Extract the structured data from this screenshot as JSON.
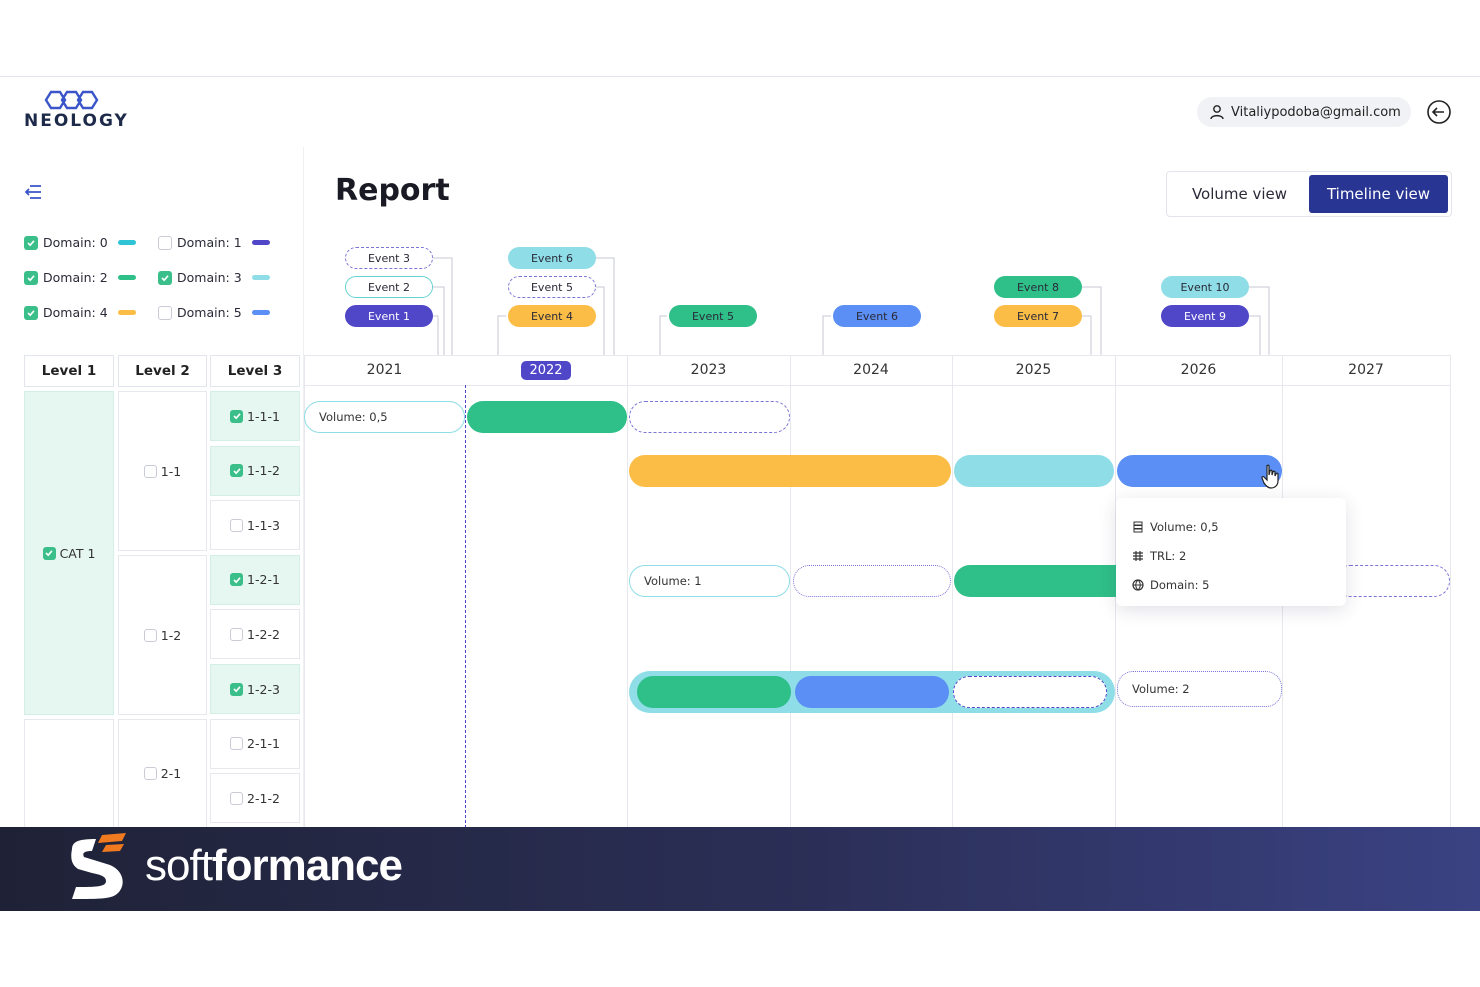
{
  "app": {
    "logo_text": "NEOLOGY",
    "user_email": "Vitaliypodoba@gmail.com"
  },
  "page": {
    "title": "Report",
    "views": [
      "Volume view",
      "Timeline view"
    ],
    "active_view": "Timeline view"
  },
  "legend": [
    {
      "label": "Domain: 0",
      "checked": true,
      "color": "#2ec4d6"
    },
    {
      "label": "Domain: 1",
      "checked": false,
      "color": "#5046c8"
    },
    {
      "label": "Domain: 2",
      "checked": true,
      "color": "#2fbf88"
    },
    {
      "label": "Domain: 3",
      "checked": true,
      "color": "#8fdde6"
    },
    {
      "label": "Domain: 4",
      "checked": true,
      "color": "#fbbd45"
    },
    {
      "label": "Domain: 5",
      "checked": false,
      "color": "#5b8ff5"
    }
  ],
  "tree": {
    "headers": [
      "Level 1",
      "Level 2",
      "Level 3"
    ],
    "level1": [
      {
        "label": "CAT 1",
        "checked": true
      }
    ],
    "level2": [
      {
        "label": "1-1",
        "checked": false
      },
      {
        "label": "1-2",
        "checked": false
      },
      {
        "label": "2-1",
        "checked": false
      }
    ],
    "level3": [
      {
        "label": "1-1-1",
        "checked": true
      },
      {
        "label": "1-1-2",
        "checked": true
      },
      {
        "label": "1-1-3",
        "checked": false
      },
      {
        "label": "1-2-1",
        "checked": true
      },
      {
        "label": "1-2-2",
        "checked": false
      },
      {
        "label": "1-2-3",
        "checked": true
      },
      {
        "label": "2-1-1",
        "checked": false
      },
      {
        "label": "2-1-2",
        "checked": false
      }
    ]
  },
  "timeline": {
    "years": [
      "2021",
      "2022",
      "2023",
      "2024",
      "2025",
      "2026",
      "2027"
    ],
    "current_year": "2022",
    "events": [
      {
        "label": "Event 3"
      },
      {
        "label": "Event 2"
      },
      {
        "label": "Event 1"
      },
      {
        "label": "Event 6"
      },
      {
        "label": "Event 5"
      },
      {
        "label": "Event 4"
      },
      {
        "label": "Event 5"
      },
      {
        "label": "Event 6"
      },
      {
        "label": "Event 8"
      },
      {
        "label": "Event 7"
      },
      {
        "label": "Event 10"
      },
      {
        "label": "Event 9"
      }
    ],
    "bar_labels": [
      "Volume: 0,5",
      "Volume: 1",
      "Volume: 2"
    ]
  },
  "tooltip": {
    "volume": "Volume: 0,5",
    "trl": "TRL: 2",
    "domain": "Domain: 5"
  },
  "colors": {
    "teal": "#2ec4d6",
    "green": "#2fbf88",
    "light_teal": "#8fdde6",
    "yellow": "#fbbd45",
    "blue": "#5b8ff5",
    "purple": "#5046c8",
    "navy": "#283593"
  },
  "banner": {
    "brand_light": "soft",
    "brand_bold": "formance"
  }
}
